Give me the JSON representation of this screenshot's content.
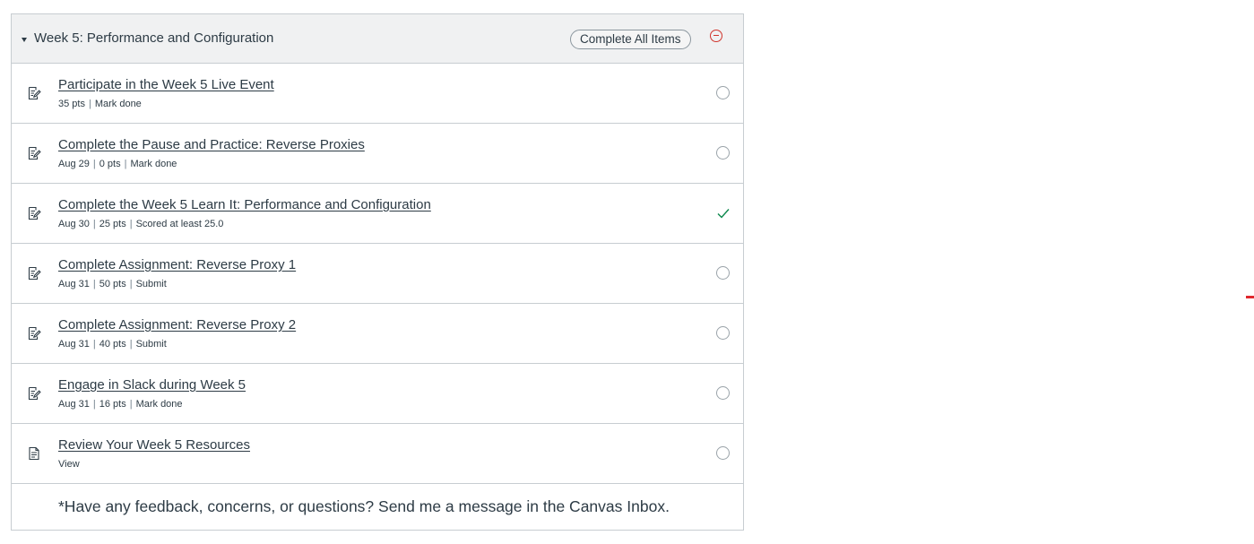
{
  "module": {
    "title": "Week 5: Performance and Configuration",
    "complete_all_label": "Complete All Items",
    "header_icon": "caret-down-icon",
    "status_icon": "incomplete-circle-icon",
    "status_color": "#d0342c"
  },
  "items": [
    {
      "icon": "assignment-icon",
      "title": "Participate in the Week 5 Live Event",
      "meta": [
        "35 pts",
        "Mark done"
      ],
      "status": "incomplete"
    },
    {
      "icon": "assignment-icon",
      "title": "Complete the Pause and Practice: Reverse Proxies",
      "meta": [
        "Aug 29",
        "0 pts",
        "Mark done"
      ],
      "status": "incomplete"
    },
    {
      "icon": "assignment-icon",
      "title": "Complete the Week 5 Learn It: Performance and Configuration",
      "meta": [
        "Aug 30",
        "25 pts",
        "Scored at least 25.0"
      ],
      "status": "complete"
    },
    {
      "icon": "assignment-icon",
      "title": "Complete Assignment: Reverse Proxy 1",
      "meta": [
        "Aug 31",
        "50 pts",
        "Submit"
      ],
      "status": "incomplete"
    },
    {
      "icon": "assignment-icon",
      "title": "Complete Assignment: Reverse Proxy 2",
      "meta": [
        "Aug 31",
        "40 pts",
        "Submit"
      ],
      "status": "incomplete"
    },
    {
      "icon": "assignment-icon",
      "title": "Engage in Slack during Week 5",
      "meta": [
        "Aug 31",
        "16 pts",
        "Mark done"
      ],
      "status": "incomplete"
    },
    {
      "icon": "page-icon",
      "title": "Review Your Week 5 Resources",
      "meta": [
        "View"
      ],
      "status": "incomplete"
    }
  ],
  "footer": {
    "text": "*Have any feedback, concerns, or questions? Send me a message in the Canvas Inbox."
  },
  "colors": {
    "text": "#2d3b45",
    "border": "#c7cdd1",
    "header_bg": "#f0f1f2",
    "complete_check": "#0b874b"
  }
}
